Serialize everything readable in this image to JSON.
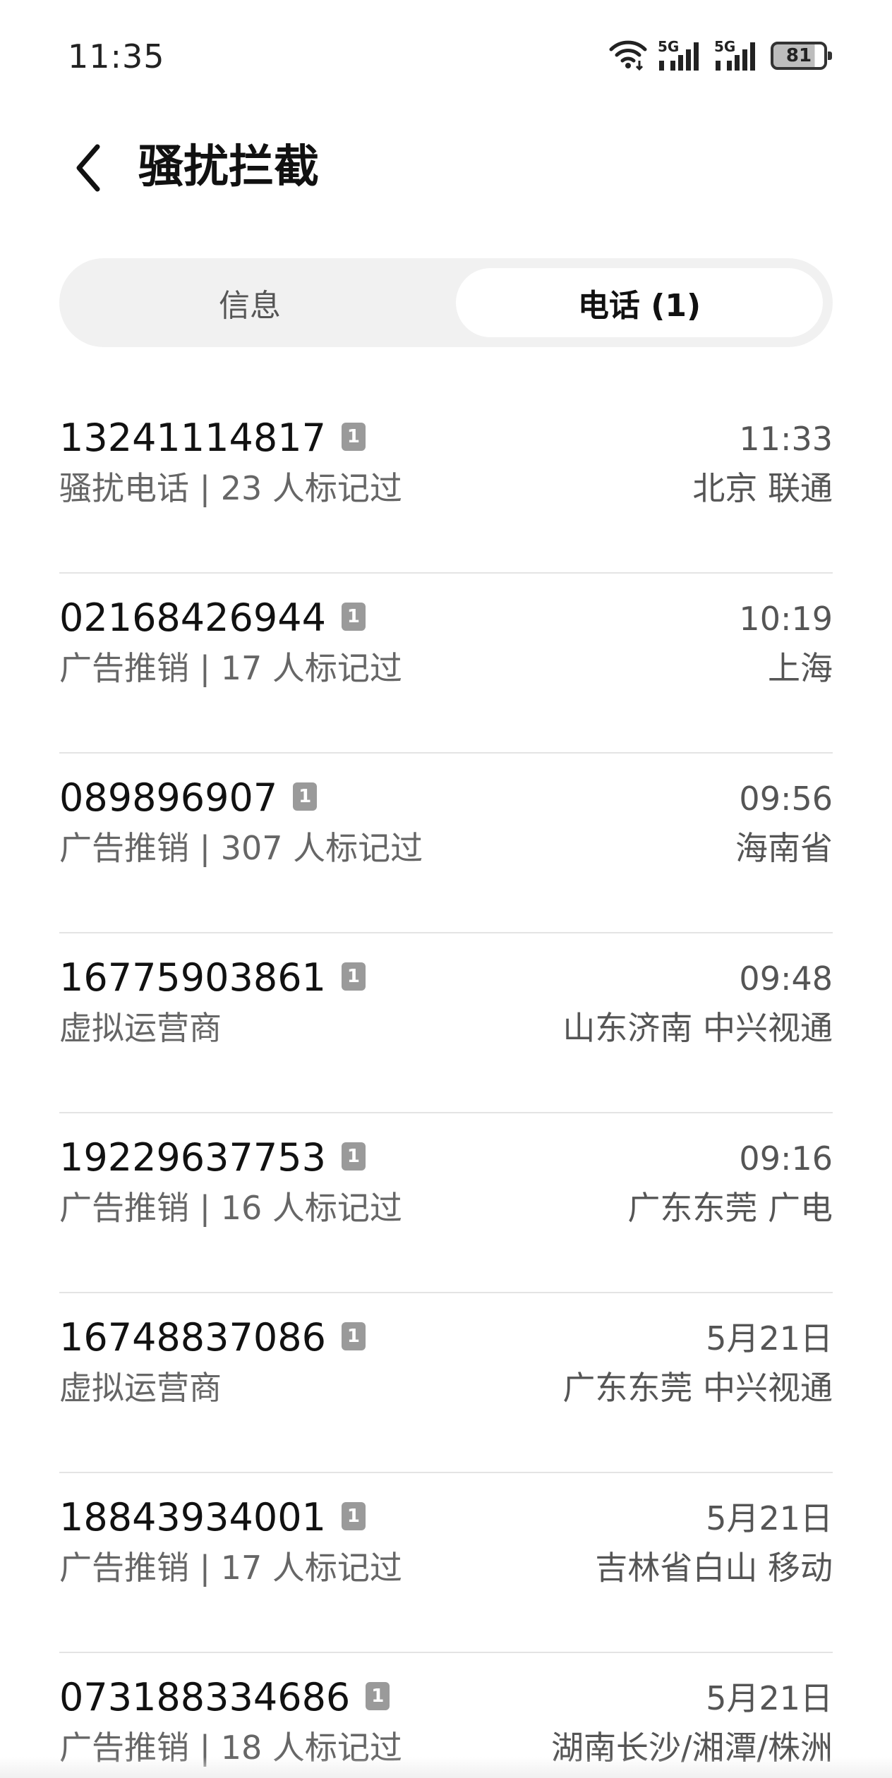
{
  "status_bar": {
    "time": "11:35",
    "sim1_label": "5G",
    "sim2_label": "5G",
    "battery": "81",
    "battery_level": 0.81,
    "icons": [
      "wifi-icon",
      "signal-icon",
      "signal-icon",
      "battery-icon"
    ]
  },
  "header": {
    "back_icon": "back-arrow-icon",
    "title": "骚扰拦截"
  },
  "tabs": {
    "messages": "信息",
    "calls": "电话 (1)",
    "selected": "calls"
  },
  "calls": [
    {
      "number": "13241114817",
      "sim": "1",
      "time": "11:33",
      "tag": "骚扰电话 | 23 人标记过",
      "location": "北京 联通"
    },
    {
      "number": "02168426944",
      "sim": "1",
      "time": "10:19",
      "tag": "广告推销 | 17 人标记过",
      "location": "上海"
    },
    {
      "number": "089896907",
      "sim": "1",
      "time": "09:56",
      "tag": "广告推销 | 307 人标记过",
      "location": "海南省"
    },
    {
      "number": "16775903861",
      "sim": "1",
      "time": "09:48",
      "tag": "虚拟运营商",
      "location": "山东济南 中兴视通"
    },
    {
      "number": "19229637753",
      "sim": "1",
      "time": "09:16",
      "tag": "广告推销 | 16 人标记过",
      "location": "广东东莞 广电"
    },
    {
      "number": "16748837086",
      "sim": "1",
      "time": "5月21日",
      "tag": "虚拟运营商",
      "location": "广东东莞 中兴视通"
    },
    {
      "number": "18843934001",
      "sim": "1",
      "time": "5月21日",
      "tag": "广告推销 | 17 人标记过",
      "location": "吉林省白山 移动"
    },
    {
      "number": "073188334686",
      "sim": "1",
      "time": "5月21日",
      "tag": "广告推销 | 18 人标记过",
      "location": "湖南长沙/湘潭/株洲"
    }
  ],
  "colors": {
    "background": "#ffffff",
    "tab_track": "#f1f1f1",
    "sim_badge": "#9a9a9a",
    "divider": "#e4e4e4"
  }
}
